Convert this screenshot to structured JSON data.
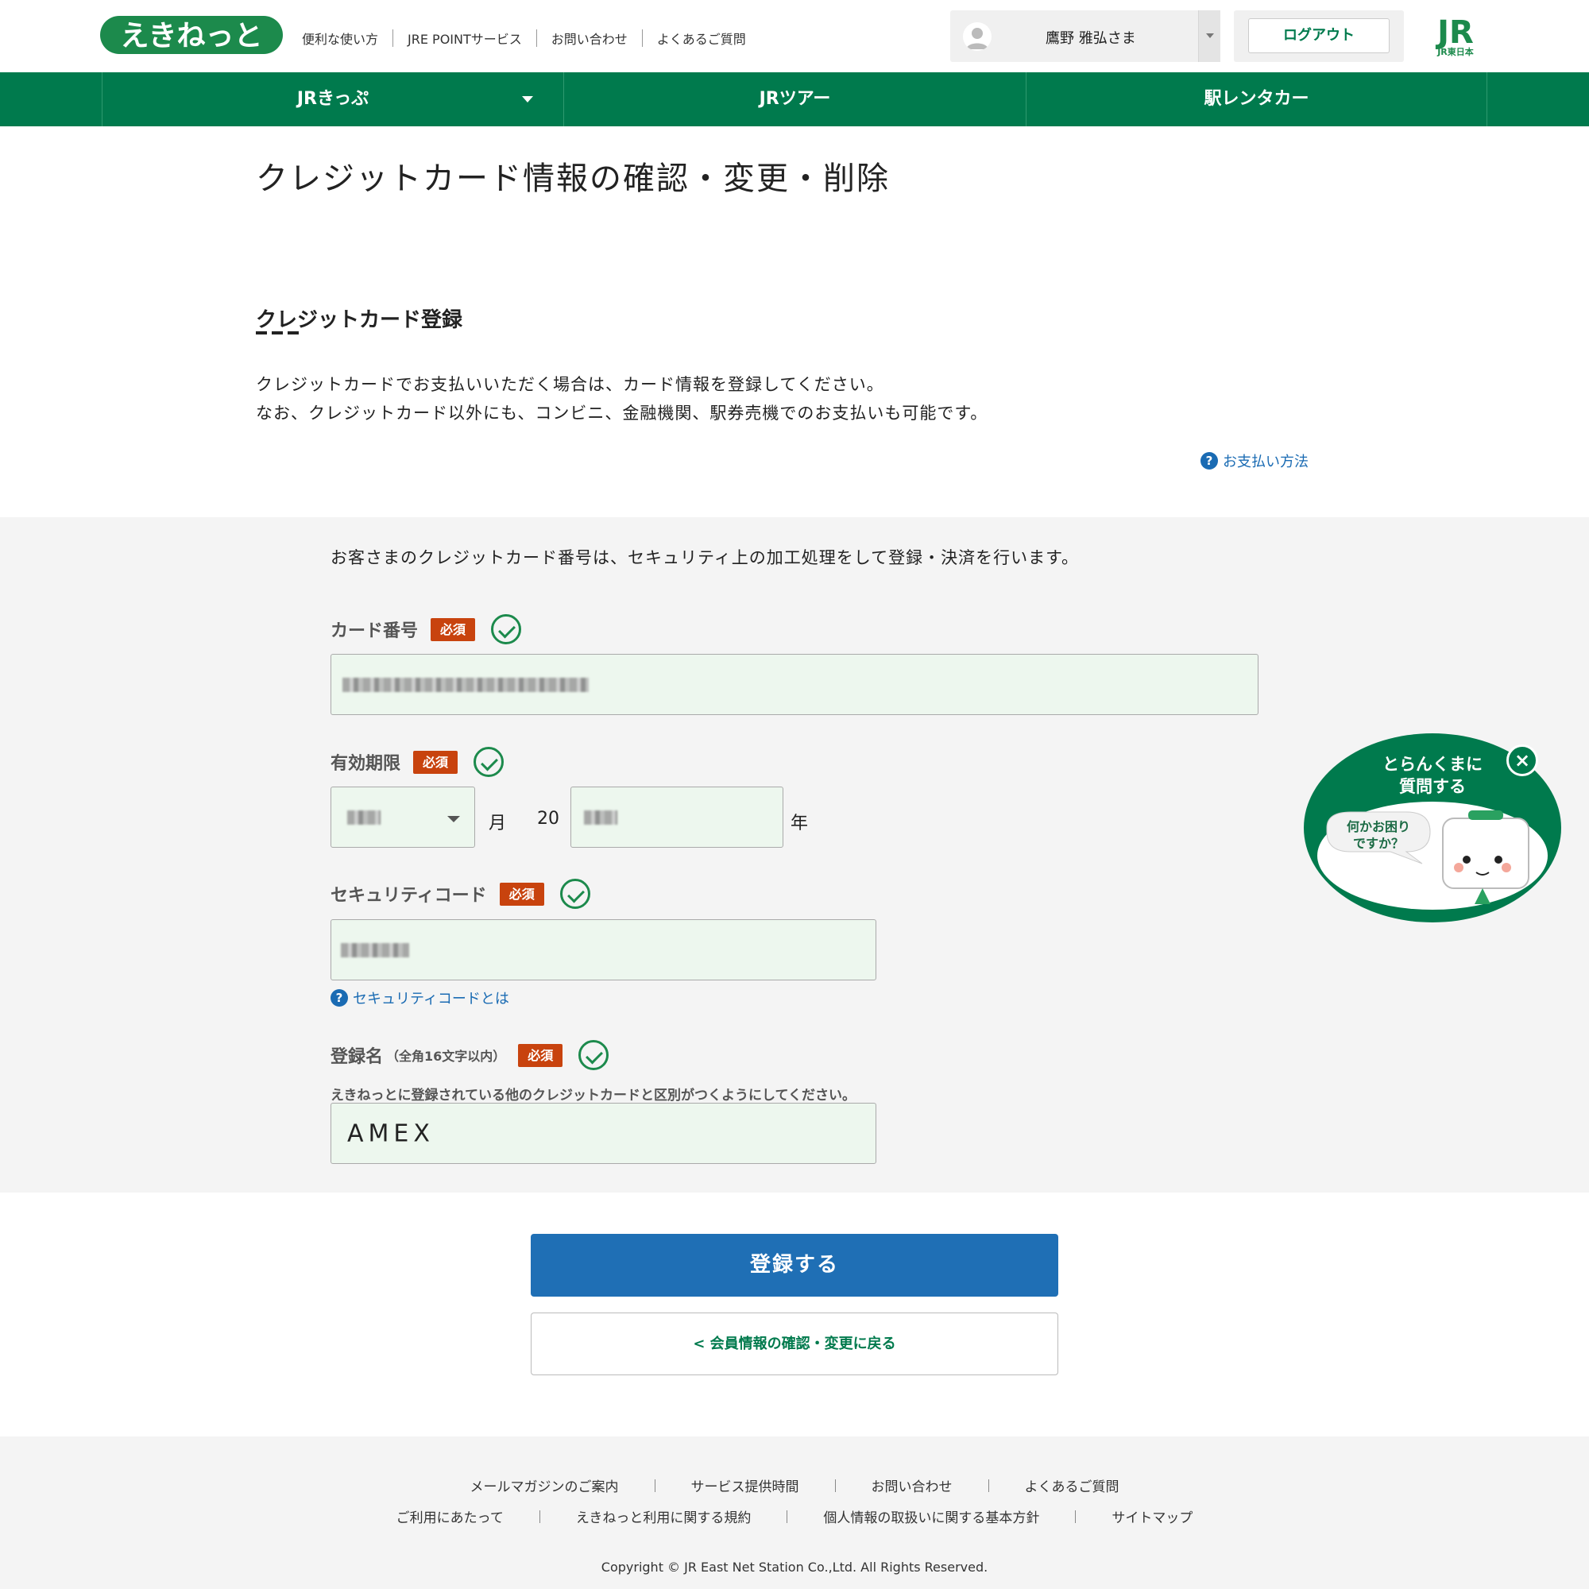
{
  "header": {
    "logo_text": "えきねっと",
    "links": [
      "便利な使い方",
      "JRE POINTサービス",
      "お問い合わせ",
      "よくあるご質問"
    ],
    "user_name": "鷹野 雅弘さま",
    "logout_label": "ログアウト",
    "jr_logo_text": "JR東日本"
  },
  "nav": {
    "items": [
      "JRきっぷ",
      "JRツアー",
      "駅レンタカー"
    ]
  },
  "page": {
    "title": "クレジットカード情報の確認・変更・削除",
    "section_title": "クレジットカード登録",
    "intro_line1": "クレジットカードでお支払いいただく場合は、カード情報を登録してください。",
    "intro_line2": "なお、クレジットカード以外にも、コンビニ、金融機関、駅券売機でのお支払いも可能です。",
    "payment_help_link": "お支払い方法"
  },
  "form": {
    "note": "お客さまのクレジットカード番号は、セキュリティ上の加工処理をして登録・決済を行います。",
    "required_badge": "必須",
    "card_number_label": "カード番号",
    "expiry_label": "有効期限",
    "month_unit": "月",
    "year_prefix": "20",
    "year_unit": "年",
    "security_code_label": "セキュリティコード",
    "security_help_link": "セキュリティコードとは",
    "reg_name_label": "登録名",
    "reg_name_sub": "（全角16文字以内）",
    "reg_name_hint": "えきねっとに登録されている他のクレジットカードと区別がつくようにしてください。",
    "reg_name_value": "AMEX"
  },
  "buttons": {
    "submit": "登録する",
    "back": "会員情報の確認・変更に戻る"
  },
  "chat_widget": {
    "title_line1": "とらんくまに",
    "title_line2": "質問する",
    "bubble_line1": "何かお困り",
    "bubble_line2": "ですか？"
  },
  "footer": {
    "row1": [
      "メールマガジンのご案内",
      "サービス提供時間",
      "お問い合わせ",
      "よくあるご質問"
    ],
    "row2": [
      "ご利用にあたって",
      "えきねっと利用に関する規約",
      "個人情報の取扱いに関する基本方針",
      "サイトマップ"
    ],
    "copyright": "Copyright © JR East Net Station Co.,Ltd. All Rights Reserved."
  },
  "colors": {
    "brand_green": "#007a4d",
    "primary_blue": "#1f6fb5",
    "required_red": "#c8430e",
    "input_bg": "#edf7ee"
  }
}
